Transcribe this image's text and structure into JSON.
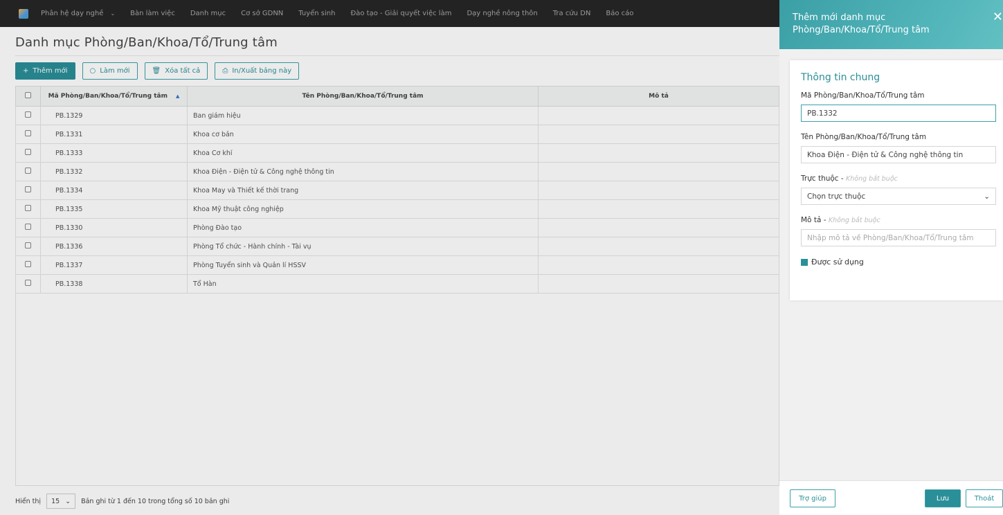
{
  "nav": {
    "items": [
      {
        "label": "Phân hệ dạy nghề",
        "dropdown": true
      },
      {
        "label": "Bàn làm việc"
      },
      {
        "label": "Danh mục"
      },
      {
        "label": "Cơ sở GDNN"
      },
      {
        "label": "Tuyển sinh"
      },
      {
        "label": "Đào tạo - Giải quyết việc làm"
      },
      {
        "label": "Dạy nghề nông thôn"
      },
      {
        "label": "Tra cứu DN"
      },
      {
        "label": "Báo cáo"
      }
    ]
  },
  "page": {
    "title": "Danh mục Phòng/Ban/Khoa/Tổ/Trung tâm"
  },
  "toolbar": {
    "add_label": "Thêm mới",
    "refresh_label": "Làm mới",
    "delete_all_label": "Xóa tất cả",
    "print_label": "In/Xuất bảng này"
  },
  "table": {
    "headers": {
      "code": "Mã Phòng/Ban/Khoa/Tổ/Trung tâm",
      "name": "Tên Phòng/Ban/Khoa/Tổ/Trung tâm",
      "desc": "Mô tả"
    },
    "rows": [
      {
        "code": "PB.1329",
        "name": "Ban giám hiệu",
        "desc": ""
      },
      {
        "code": "PB.1331",
        "name": "Khoa cơ bản",
        "desc": ""
      },
      {
        "code": "PB.1333",
        "name": "Khoa Cơ khí",
        "desc": ""
      },
      {
        "code": "PB.1332",
        "name": "Khoa Điện - Điện tử & Công nghệ thông tin",
        "desc": ""
      },
      {
        "code": "PB.1334",
        "name": "Khoa May và Thiết kế thời trang",
        "desc": ""
      },
      {
        "code": "PB.1335",
        "name": "Khoa Mỹ thuật công nghiệp",
        "desc": ""
      },
      {
        "code": "PB.1330",
        "name": "Phòng Đào tạo",
        "desc": ""
      },
      {
        "code": "PB.1336",
        "name": "Phòng Tổ chức - Hành chính - Tài vụ",
        "desc": ""
      },
      {
        "code": "PB.1337",
        "name": "Phòng Tuyển sinh và Quản lí HSSV",
        "desc": ""
      },
      {
        "code": "PB.1338",
        "name": "Tổ Hàn",
        "desc": ""
      }
    ]
  },
  "footer": {
    "show_label": "Hiển thị",
    "page_size": "15",
    "summary": "Bản ghi từ 1 đến 10 trong tổng số 10 bản ghi"
  },
  "panel": {
    "title_line1": "Thêm mới danh mục",
    "title_line2": "Phòng/Ban/Khoa/Tổ/Trung tâm",
    "section_title": "Thông tin chung",
    "code_label": "Mã Phòng/Ban/Khoa/Tổ/Trung tâm",
    "code_value": "PB.1332",
    "name_label": "Tên Phòng/Ban/Khoa/Tổ/Trung tâm",
    "name_value": "Khoa Điện - Điện tử & Công nghệ thông tin",
    "parent_label": "Trực thuộc",
    "optional_text": "Không bắt buộc",
    "parent_value": "Chọn trực thuộc",
    "desc_label": "Mô tả",
    "desc_placeholder": "Nhập mô tả về Phòng/Ban/Khoa/Tổ/Trung tâm",
    "used_label": "Được sử dụng",
    "used_checked": true,
    "help_label": "Trợ giúp",
    "save_label": "Lưu",
    "exit_label": "Thoát"
  },
  "colors": {
    "accent": "#2a8f98",
    "nav_bg": "#232323"
  }
}
